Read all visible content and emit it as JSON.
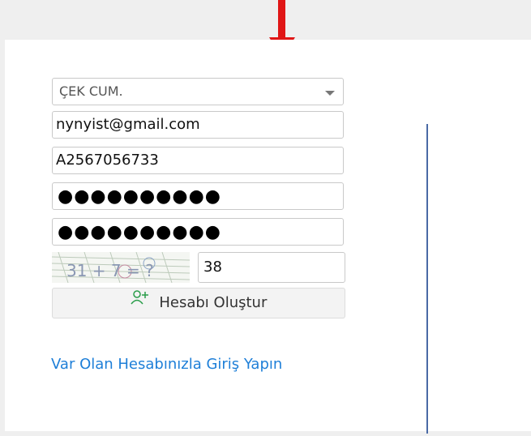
{
  "form": {
    "select_value": "ÇEK CUM.",
    "email_value": "nynyist@gmail.com",
    "id_value": "A2567056733",
    "password_dots": "●●●●●●●●●●",
    "password_confirm_dots": "●●●●●●●●●●",
    "captcha_text": "31 + 7 = ?",
    "captcha_answer": "38",
    "create_button_label": "Hesabı Oluştur",
    "login_link_text": "Var Olan Hesabınızla Giriş Yapın"
  },
  "icons": {
    "arrow": "red-down-arrow-icon",
    "create": "add-user-icon",
    "select": "chevron-down-icon"
  },
  "colors": {
    "arrow": "#e01616",
    "link": "#1e7fd8",
    "divider": "#4a6aa5",
    "icon_green": "#2a9d4a"
  }
}
